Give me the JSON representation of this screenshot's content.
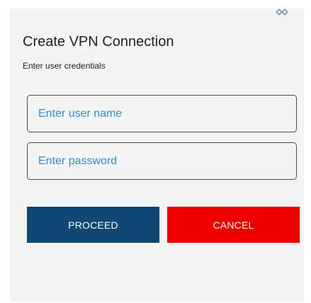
{
  "dialog": {
    "title": "Create VPN Connection",
    "subtitle": "Enter user credentials",
    "top_icon": "settings-gear-icon"
  },
  "form": {
    "username_placeholder": "Enter user name",
    "username_value": "",
    "password_placeholder": "Enter password",
    "password_value": ""
  },
  "actions": {
    "proceed_label": "PROCEED",
    "cancel_label": "CANCEL"
  },
  "colors": {
    "dialog_background": "#f4f4f4",
    "placeholder_text": "#2c8ed6",
    "proceed_button": "#0e4773",
    "cancel_button": "#ef0000",
    "field_border": "#4a4a4a"
  }
}
